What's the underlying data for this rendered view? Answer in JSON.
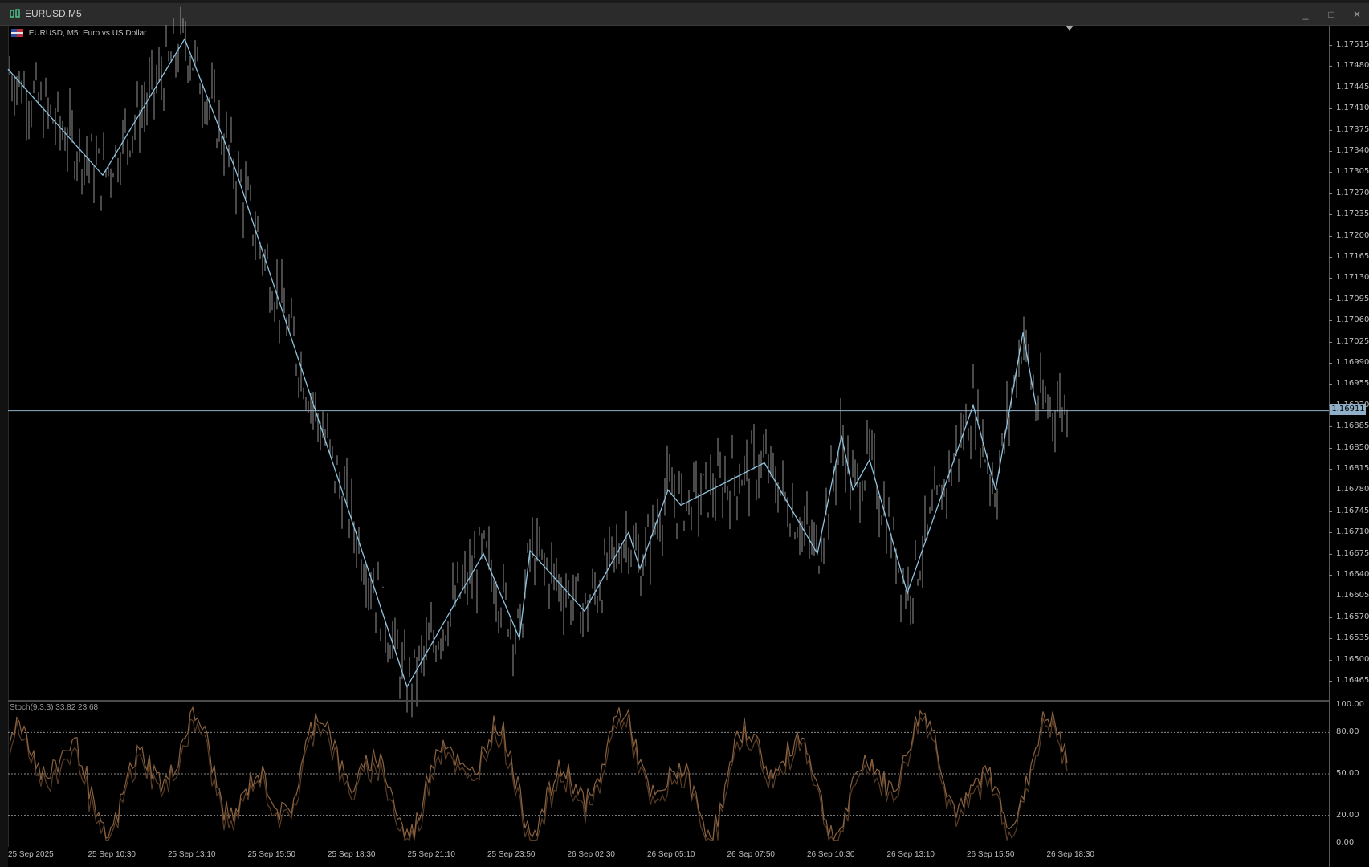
{
  "window": {
    "title": "EURUSD,M5",
    "controls": [
      "_",
      "□",
      "✕"
    ]
  },
  "chart": {
    "header": "EURUSD, M5:  Euro vs US Dollar",
    "current_price": "1.16911",
    "colors": {
      "background": "#000000",
      "candles": "#b0b0b0",
      "zigzag": "#8fc3df",
      "stoch": "#8a6240",
      "price_line": "#8fb0c8"
    }
  },
  "price_axis": [
    "1.17515",
    "1.17480",
    "1.17445",
    "1.17410",
    "1.17375",
    "1.17340",
    "1.17305",
    "1.17270",
    "1.17235",
    "1.17200",
    "1.17165",
    "1.17130",
    "1.17095",
    "1.17060",
    "1.17025",
    "1.16990",
    "1.16955",
    "1.16920",
    "1.16885",
    "1.16850",
    "1.16815",
    "1.16780",
    "1.16745",
    "1.16710",
    "1.16675",
    "1.16640",
    "1.16605",
    "1.16570",
    "1.16535",
    "1.16500",
    "1.16465"
  ],
  "stoch": {
    "label": "Stoch(9,3,3) 33.82 23.68",
    "axis": [
      "100.00",
      "80.00",
      "50.00",
      "20.00",
      "0.00"
    ]
  },
  "time_axis": [
    "25 Sep 2025",
    "25 Sep 10:30",
    "25 Sep 13:10",
    "25 Sep 15:50",
    "25 Sep 18:30",
    "25 Sep 21:10",
    "25 Sep 23:50",
    "26 Sep 02:30",
    "26 Sep 05:10",
    "26 Sep 07:50",
    "26 Sep 10:30",
    "26 Sep 13:10",
    "26 Sep 15:50",
    "26 Sep 18:30"
  ],
  "chart_data": {
    "type": "line",
    "series": [
      {
        "name": "ZigZag",
        "values": [
          1.17475,
          1.173,
          1.17525,
          1.1731,
          1.16455,
          1.16675,
          1.16535,
          1.1668,
          1.1658,
          1.1671,
          1.1665,
          1.1678,
          1.16755,
          1.16825,
          1.16675,
          1.1687,
          1.1678,
          1.1683,
          1.1661,
          1.1692,
          1.1678,
          1.1704,
          1.1692
        ]
      }
    ],
    "ylim": [
      1.1645,
      1.1753
    ]
  }
}
